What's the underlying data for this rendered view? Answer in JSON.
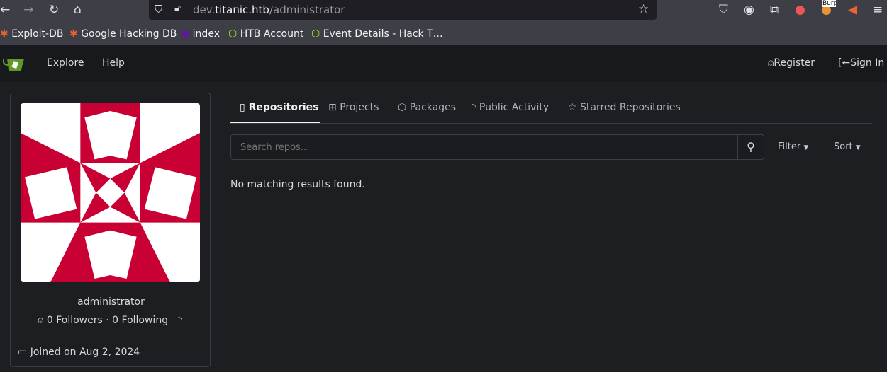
{
  "browser": {
    "url_prefix": "dev.",
    "url_domain": "titanic.htb",
    "url_path": "/administrator",
    "bookmarks": [
      "Exploit-DB",
      "Google Hacking DB",
      "index",
      "HTB Account",
      "Event Details - Hack T…"
    ],
    "ext_badge": "Burp"
  },
  "nav": {
    "explore": "Explore",
    "help": "Help",
    "register": "Register",
    "sign_in": "Sign In"
  },
  "profile": {
    "username": "administrator",
    "followers": "0 Followers",
    "separator": "·",
    "following": "0 Following",
    "joined": "Joined on Aug 2, 2024"
  },
  "tabs": [
    "Repositories",
    "Projects",
    "Packages",
    "Public Activity",
    "Starred Repositories"
  ],
  "search": {
    "placeholder": "Search repos..."
  },
  "filter": "Filter",
  "sort": "Sort",
  "empty": "No matching results found.",
  "colors": {
    "avatar_red": "#c80033",
    "accent_green": "#609926"
  }
}
